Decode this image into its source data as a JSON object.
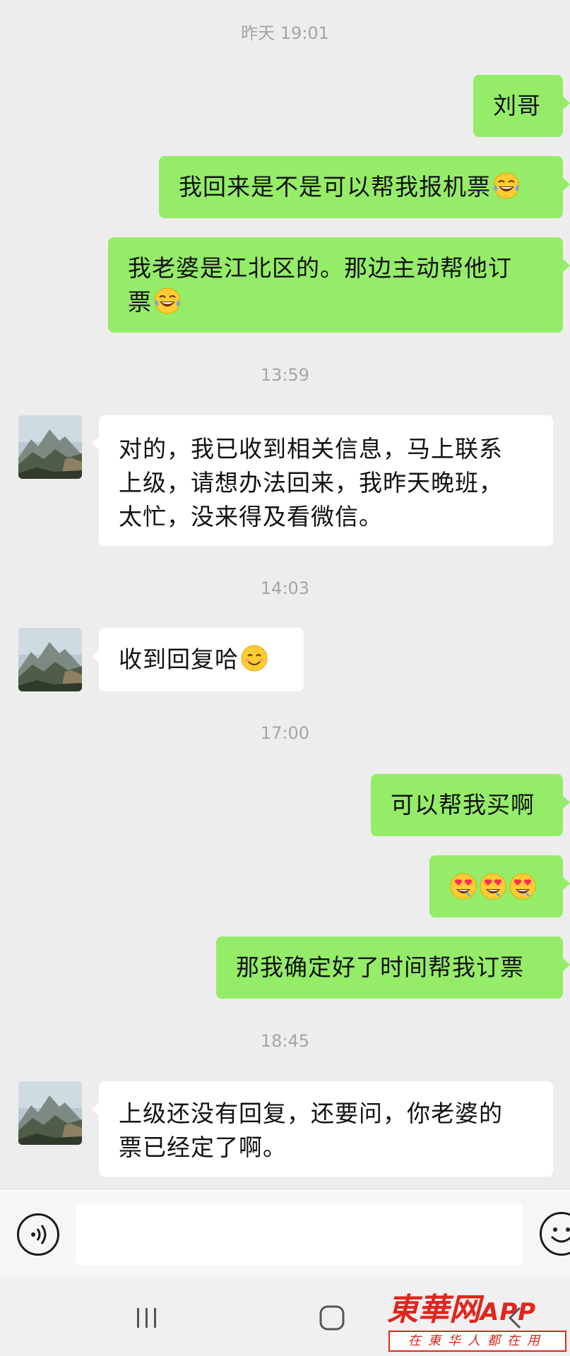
{
  "messages": {
    "ts1": "昨天 19:01",
    "m1": "刘哥",
    "m2": "我回来是不是可以帮我报机票",
    "m3_line1": "我老婆是江北区的。那边主动帮他订",
    "m3_line2": "票",
    "ts2": "13:59",
    "m4_line1": "对的，我已收到相关信息，马上联系",
    "m4_line2": "上级，请想办法回来，我昨天晚班，",
    "m4_line3": "太忙，没来得及看微信。",
    "ts3": "14:03",
    "m5": "收到回复哈",
    "ts4": "17:00",
    "m6": "可以帮我买啊",
    "m8": "那我确定好了时间帮我订票",
    "ts5": "18:45",
    "m9_line1": "上级还没有回复，还要问，你老婆的",
    "m9_line2": "票已经定了啊。"
  },
  "icons": {
    "laughing": "rolling-laughing-emoji",
    "smile": "smiling-face-emoji",
    "heart_eyes": "heart-eyes-emoji",
    "voice": "voice-icon",
    "emoji_btn": "emoji-icon"
  },
  "colors": {
    "outgoing_bubble": "#95ec69",
    "incoming_bubble": "#ffffff",
    "background": "#ededed",
    "watermark": "#e0261c"
  },
  "watermark": {
    "brand": "東華网",
    "app": "APP",
    "slogan": "在東华人都在用"
  }
}
